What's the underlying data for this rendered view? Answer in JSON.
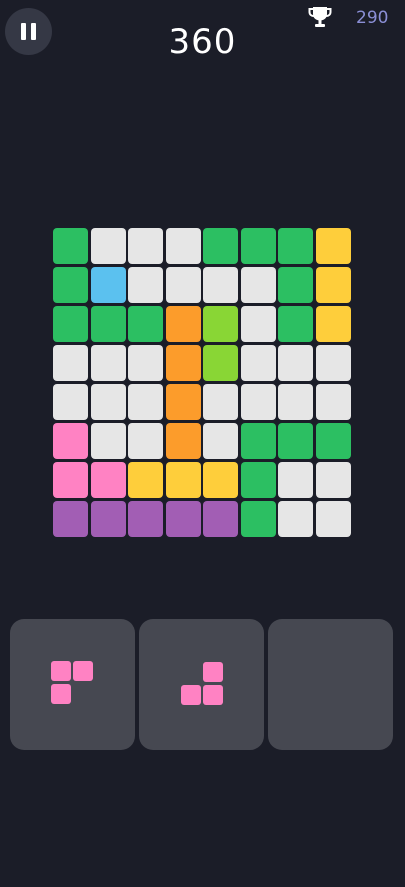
{
  "header": {
    "score": "360",
    "best_score": "290",
    "pause_icon": "pause-icon",
    "trophy_icon": "trophy-icon"
  },
  "colors": {
    "G": "#2cbf62",
    "W": "#e6e6e6",
    "Y": "#fece3b",
    "B": "#5bc1ef",
    "O": "#fc9c2b",
    "L": "#89d635",
    "P": "#ff82c3",
    "V": "#a25eb4",
    "piece": "#ff82c3",
    "slot": "#464851",
    "background": "#1b1d28",
    "score_text": "#ffffff",
    "best_text": "#8b8fd6"
  },
  "board": {
    "rows": [
      [
        "G",
        "W",
        "W",
        "W",
        "G",
        "G",
        "G",
        "Y"
      ],
      [
        "G",
        "B",
        "W",
        "W",
        "W",
        "W",
        "G",
        "Y"
      ],
      [
        "G",
        "G",
        "G",
        "O",
        "L",
        "W",
        "G",
        "Y"
      ],
      [
        "W",
        "W",
        "W",
        "O",
        "L",
        "W",
        "W",
        "W"
      ],
      [
        "W",
        "W",
        "W",
        "O",
        "W",
        "W",
        "W",
        "W"
      ],
      [
        "P",
        "W",
        "W",
        "O",
        "W",
        "G",
        "G",
        "G"
      ],
      [
        "P",
        "P",
        "Y",
        "Y",
        "Y",
        "G",
        "W",
        "W"
      ],
      [
        "V",
        "V",
        "V",
        "V",
        "V",
        "G",
        "W",
        "W"
      ]
    ]
  },
  "pieces": [
    {
      "blocks": [
        [
          0,
          0
        ],
        [
          1,
          0
        ],
        [
          0,
          1
        ]
      ]
    },
    {
      "blocks": [
        [
          1,
          0
        ],
        [
          0,
          1
        ],
        [
          1,
          1
        ]
      ]
    },
    {
      "blocks": []
    }
  ]
}
